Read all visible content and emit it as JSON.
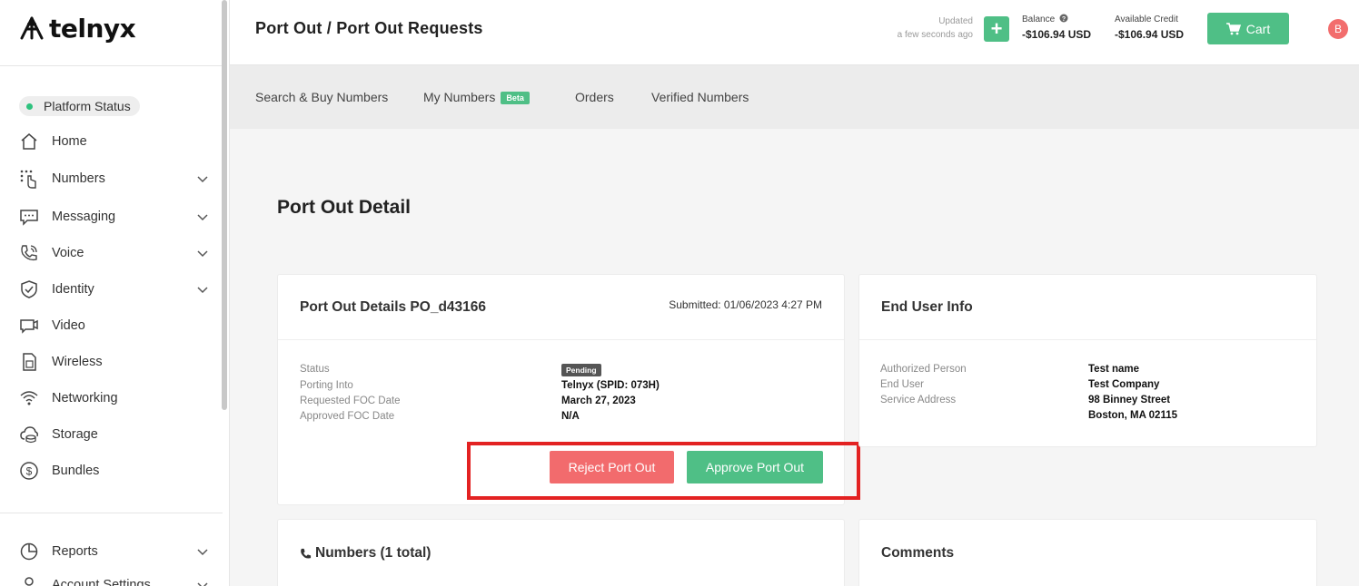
{
  "brand": {
    "name": "telnyx"
  },
  "sidebar": {
    "platform_status": "Platform Status",
    "items": [
      {
        "label": "Home",
        "icon": "home-icon"
      },
      {
        "label": "Numbers",
        "icon": "numbers-icon"
      },
      {
        "label": "Messaging",
        "icon": "messaging-icon"
      },
      {
        "label": "Voice",
        "icon": "voice-icon"
      },
      {
        "label": "Identity",
        "icon": "shield-icon"
      },
      {
        "label": "Video",
        "icon": "video-icon"
      },
      {
        "label": "Wireless",
        "icon": "sim-card-icon"
      },
      {
        "label": "Networking",
        "icon": "wifi-icon"
      },
      {
        "label": "Storage",
        "icon": "cloud-storage-icon"
      },
      {
        "label": "Bundles",
        "icon": "dollar-icon"
      },
      {
        "label": "Reports",
        "icon": "pie-chart-icon"
      },
      {
        "label": "Account Settings",
        "icon": "user-icon"
      }
    ]
  },
  "header": {
    "title": "Port Out / Port Out Requests",
    "updated_label": "Updated",
    "updated_time": "a few seconds ago",
    "balance_label": "Balance",
    "balance_value": "-$106.94 USD",
    "credit_label": "Available Credit",
    "credit_value": "-$106.94 USD",
    "cart_label": "Cart",
    "avatar_initial": "B"
  },
  "subnav": {
    "items": [
      "Search & Buy Numbers",
      "My Numbers",
      "Orders",
      "Verified Numbers"
    ],
    "beta_badge": "Beta"
  },
  "main": {
    "title": "Port Out Detail",
    "details_card": {
      "title": "Port Out Details PO_d43166",
      "submitted": "Submitted: 01/06/2023 4:27 PM",
      "status_label": "Status",
      "status_value": "Pending",
      "porting_into_label": "Porting Into",
      "porting_into_value": "Telnyx (SPID: 073H)",
      "requested_foc_label": "Requested FOC Date",
      "requested_foc_value": "March 27, 2023",
      "approved_foc_label": "Approved FOC Date",
      "approved_foc_value": "N/A",
      "reject_button": "Reject Port Out",
      "approve_button": "Approve Port Out"
    },
    "end_user_card": {
      "title": "End User Info",
      "authorized_label": "Authorized Person",
      "authorized_value": "Test name",
      "end_user_label": "End User",
      "end_user_value": "Test Company",
      "address_label": "Service Address",
      "address_line1": "98 Binney Street",
      "address_line2": "Boston, MA 02115"
    },
    "numbers_card": {
      "title": "Numbers (1 total)"
    },
    "comments_card": {
      "title": "Comments"
    }
  },
  "colors": {
    "accent_green": "#4fbf86",
    "danger_red": "#f26b6d",
    "highlight_red": "#e32222"
  }
}
